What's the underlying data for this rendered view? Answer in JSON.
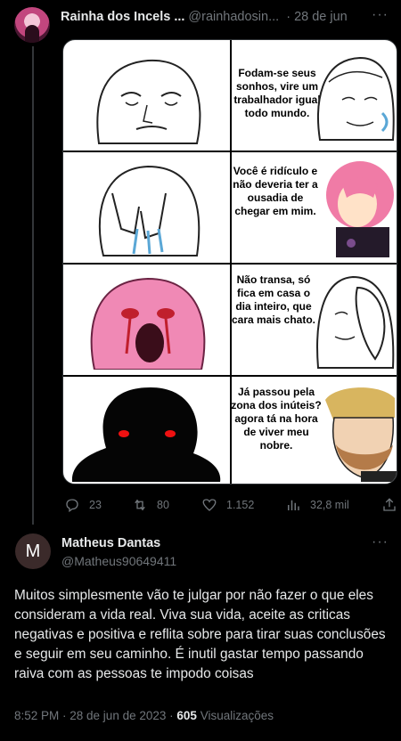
{
  "parent_tweet": {
    "display_name": "Rainha dos Incels ...",
    "handle": "@rainhadosin...",
    "date": "· 28 de jun",
    "more": "···",
    "meme_panels": [
      {
        "text": "Fodam-se seus sonhos, vire um trabalhador igual todo mundo."
      },
      {
        "text": "Você é ridículo e não deveria ter a ousadia de chegar em mim."
      },
      {
        "text": "Não transa, só fica em casa o dia inteiro, que cara mais chato."
      },
      {
        "text": "Já passou pela zona dos inúteis? agora tá na hora de viver meu nobre."
      }
    ],
    "actions": {
      "replies": "23",
      "retweets": "80",
      "likes": "1.152",
      "views": "32,8 mil"
    }
  },
  "main_tweet": {
    "avatar_letter": "M",
    "display_name": "Matheus Dantas",
    "handle": "@Matheus90649411",
    "more": "···",
    "text": "Muitos simplesmente vão te julgar por não fazer o que eles consideram a vida real. Viva sua vida, aceite as criticas negativas e positiva e reflita sobre para tirar suas conclusões e seguir em seu caminho. É inutil gastar tempo passando raiva com as pessoas te impodo coisas",
    "time": "8:52 PM · 28 de jun de 2023 ·",
    "views_count": "605",
    "views_label": "Visualizações"
  }
}
